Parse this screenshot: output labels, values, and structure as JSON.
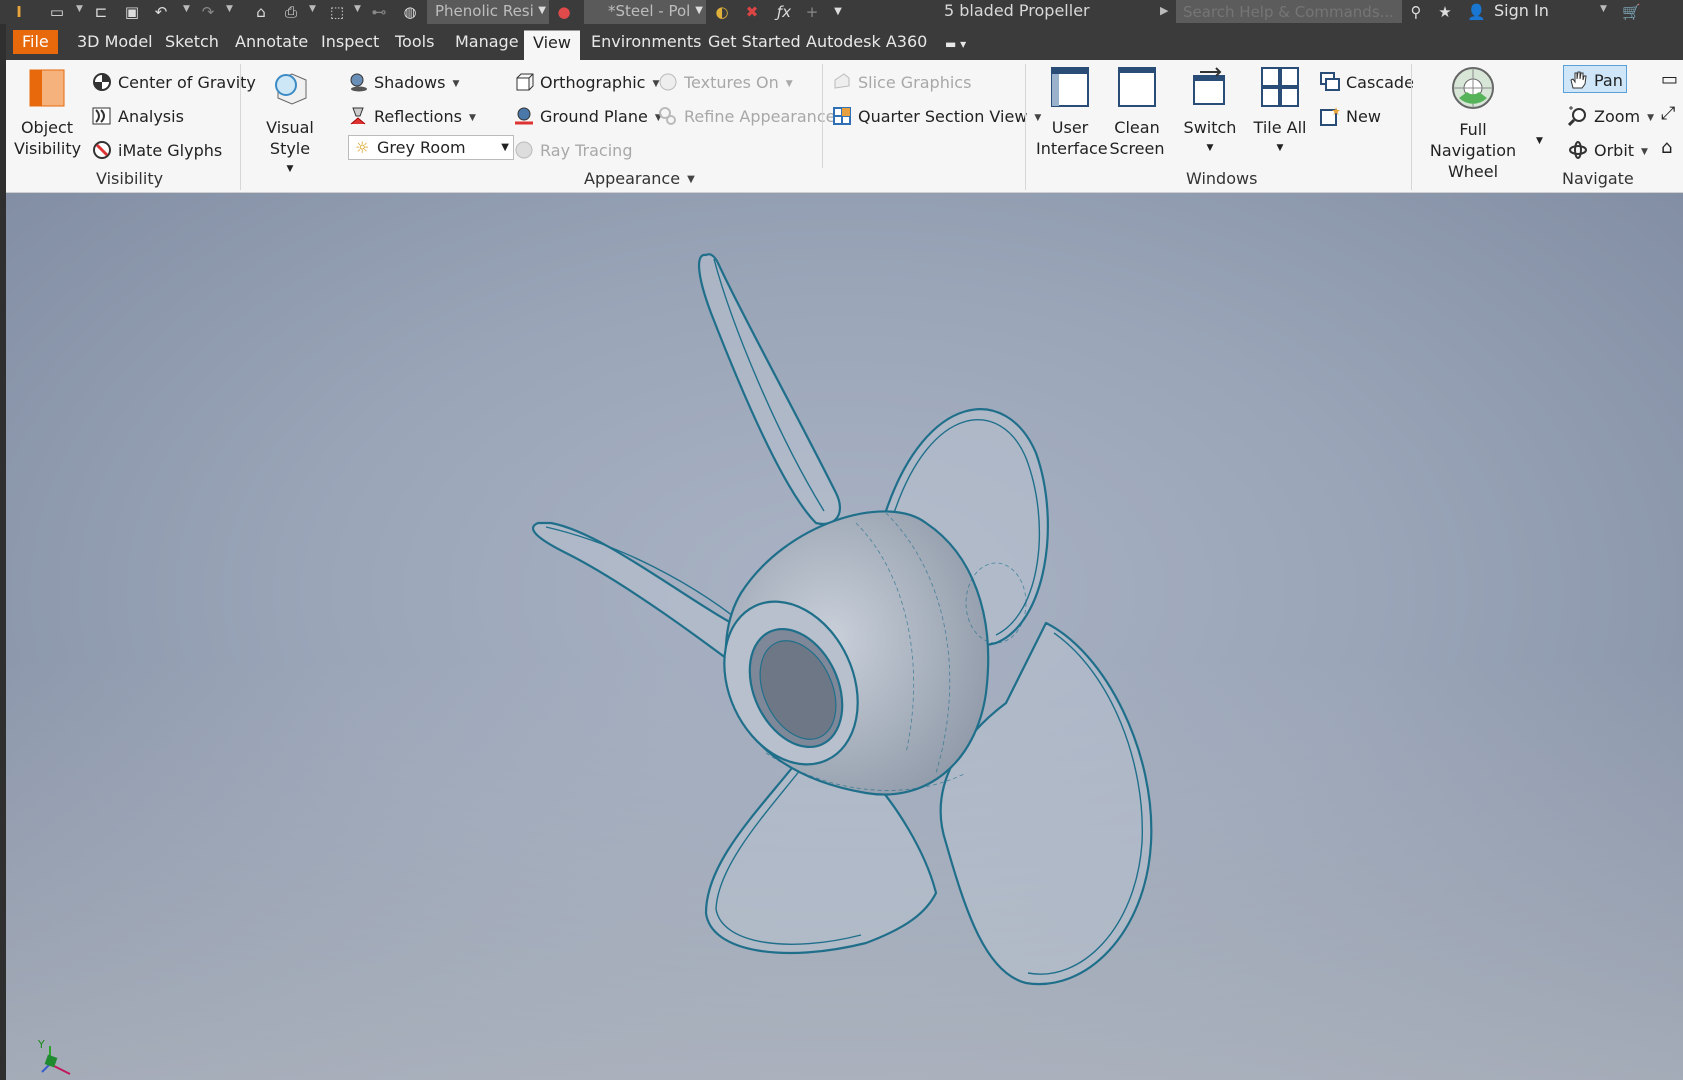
{
  "quick_access": {
    "material": "Phenolic Resi",
    "appearance": "*Steel - Pol",
    "document_title": "5 bladed Propeller",
    "help_search_placeholder": "Search Help & Commands...",
    "sign_in": "Sign In"
  },
  "menu_tabs": [
    "File",
    "3D Model",
    "Sketch",
    "Annotate",
    "Inspect",
    "Tools",
    "Manage",
    "View",
    "Environments",
    "Get Started",
    "Autodesk A360"
  ],
  "active_tab": "View",
  "ribbon": {
    "visibility": {
      "label": "Visibility",
      "object_visibility": "Object Visibility",
      "center_of_gravity": "Center of Gravity",
      "analysis": "Analysis",
      "imate_glyphs": "iMate Glyphs"
    },
    "appearance": {
      "label": "Appearance",
      "visual_style": "Visual Style",
      "shadows": "Shadows",
      "reflections": "Reflections",
      "lighting_style": "Grey Room",
      "orthographic": "Orthographic",
      "ground_plane": "Ground Plane",
      "ray_tracing": "Ray Tracing",
      "textures_on": "Textures On",
      "refine_appearance": "Refine Appearance",
      "slice_graphics": "Slice Graphics",
      "quarter_section_view": "Quarter Section View"
    },
    "windows": {
      "label": "Windows",
      "user_interface": "User Interface",
      "clean_screen": "Clean Screen",
      "switch": "Switch",
      "tile_all": "Tile All",
      "cascade": "Cascade",
      "new": "New"
    },
    "navigate": {
      "label": "Navigate",
      "full_navigation_wheel": "Full Navigation Wheel",
      "pan": "Pan",
      "zoom": "Zoom",
      "orbit": "Orbit"
    }
  },
  "triad": {
    "y_label": "Y"
  },
  "colors": {
    "file_tab": "#e8690c",
    "model_edges": "#1f6f8b",
    "model_fill": "#b9c2cf",
    "pan_highlight": "#cfe6f8"
  }
}
